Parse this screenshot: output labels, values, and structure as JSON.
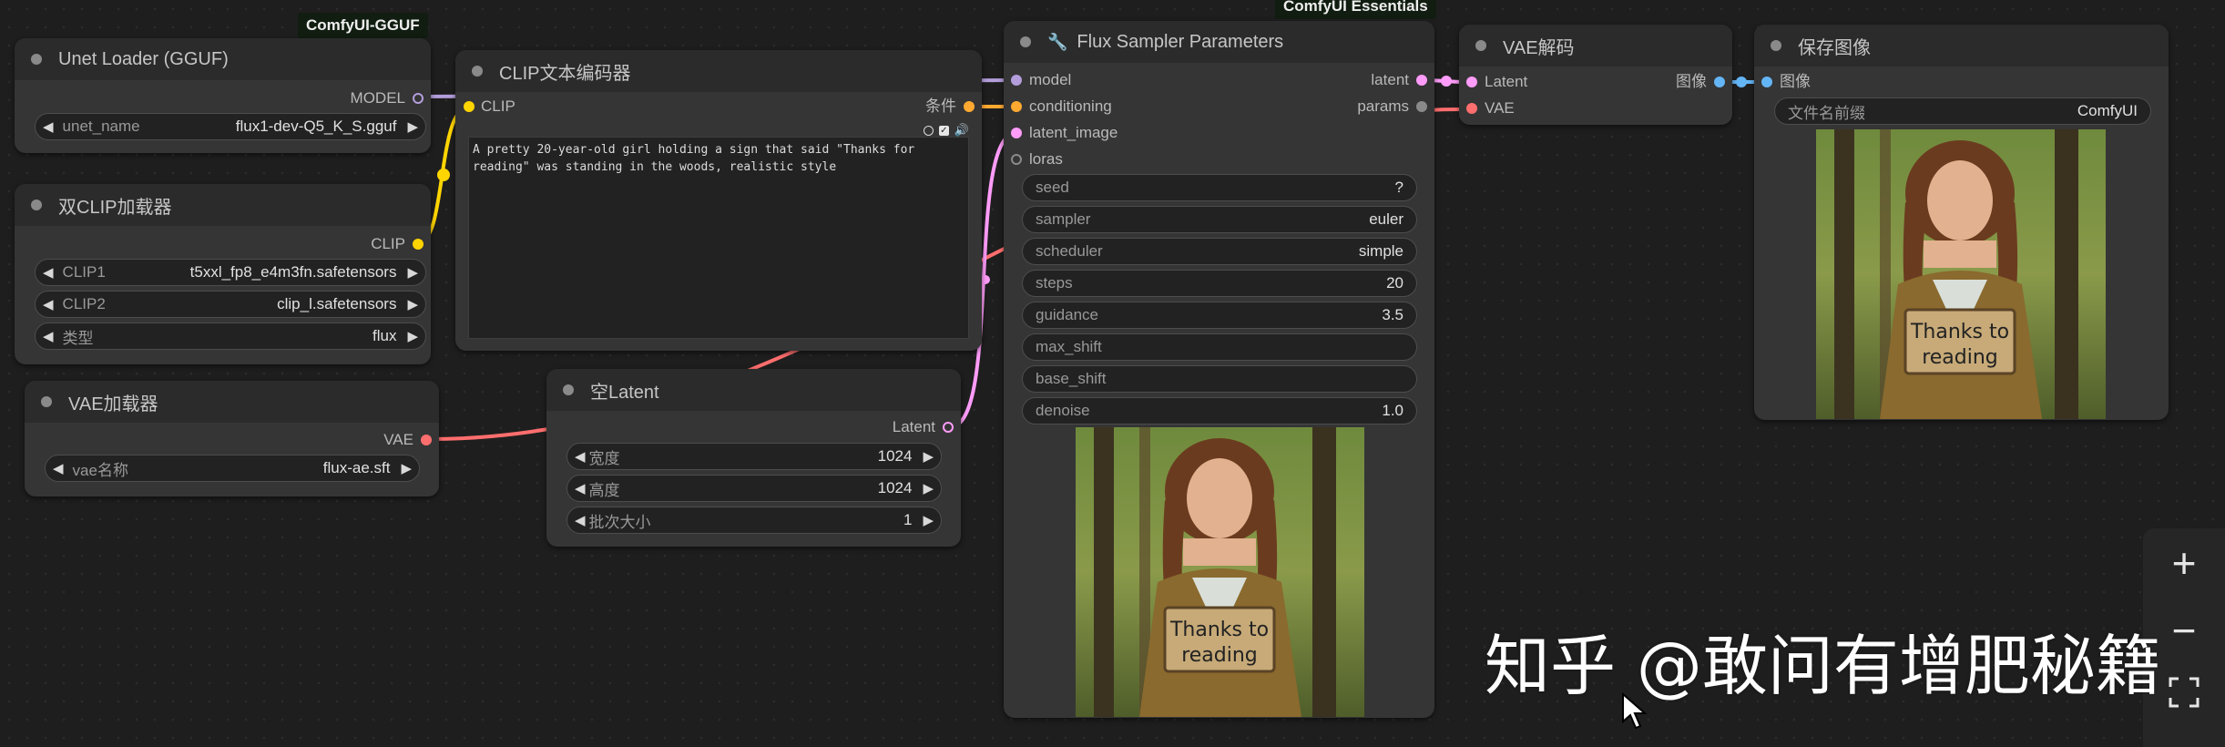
{
  "badges": {
    "gguf": "ComfyUI-GGUF",
    "essentials": "ComfyUI Essentials"
  },
  "unet_loader": {
    "title": "Unet Loader (GGUF)",
    "output_label": "MODEL",
    "widgets": [
      {
        "label": "unet_name",
        "value": "flux1-dev-Q5_K_S.gguf"
      }
    ]
  },
  "dual_clip": {
    "title": "双CLIP加载器",
    "output_label": "CLIP",
    "widgets": [
      {
        "label": "CLIP1",
        "value": "t5xxl_fp8_e4m3fn.safetensors"
      },
      {
        "label": "CLIP2",
        "value": "clip_l.safetensors"
      },
      {
        "label": "类型",
        "value": "flux"
      }
    ]
  },
  "vae_loader": {
    "title": "VAE加载器",
    "output_label": "VAE",
    "widgets": [
      {
        "label": "vae名称",
        "value": "flux-ae.sft"
      }
    ]
  },
  "clip_encoder": {
    "title": "CLIP文本编码器",
    "input_label": "CLIP",
    "output_label": "条件",
    "prompt": "A pretty 20-year-old girl holding a sign that said \"Thanks for reading\" was standing in the woods, realistic style"
  },
  "empty_latent": {
    "title": "空Latent",
    "output_label": "Latent",
    "widgets": [
      {
        "label": "宽度",
        "value": "1024"
      },
      {
        "label": "高度",
        "value": "1024"
      },
      {
        "label": "批次大小",
        "value": "1"
      }
    ]
  },
  "flux_sampler": {
    "title": "Flux Sampler Parameters",
    "title_icon": "wrench-icon",
    "inputs": [
      "model",
      "conditioning",
      "latent_image",
      "loras"
    ],
    "outputs": [
      "latent",
      "params"
    ],
    "widgets": [
      {
        "label": "seed",
        "value": "?"
      },
      {
        "label": "sampler",
        "value": "euler"
      },
      {
        "label": "scheduler",
        "value": "simple"
      },
      {
        "label": "steps",
        "value": "20"
      },
      {
        "label": "guidance",
        "value": "3.5"
      },
      {
        "label": "max_shift",
        "value": ""
      },
      {
        "label": "base_shift",
        "value": ""
      },
      {
        "label": "denoise",
        "value": "1.0"
      }
    ],
    "sign_text": [
      "Thanks to",
      "reading"
    ]
  },
  "vae_decode": {
    "title": "VAE解码",
    "inputs": [
      "Latent",
      "VAE"
    ],
    "output_label": "图像"
  },
  "save_image": {
    "title": "保存图像",
    "input_label": "图像",
    "widgets": [
      {
        "label": "文件名前缀",
        "value": "ComfyUI"
      }
    ],
    "sign_text": [
      "Thanks to",
      "reading"
    ]
  },
  "zoom_controls": {
    "zoom_in": "+",
    "zoom_out": "−",
    "fit_icon": "fit-view-icon"
  },
  "watermark": "知乎 @敢问有增肥秘籍",
  "colors": {
    "model": "#b39ddb",
    "clip": "#ffd500",
    "conditioning": "#ffa931",
    "latent": "#ff9cf9",
    "vae": "#ff6e6e",
    "image": "#64b5f6"
  }
}
